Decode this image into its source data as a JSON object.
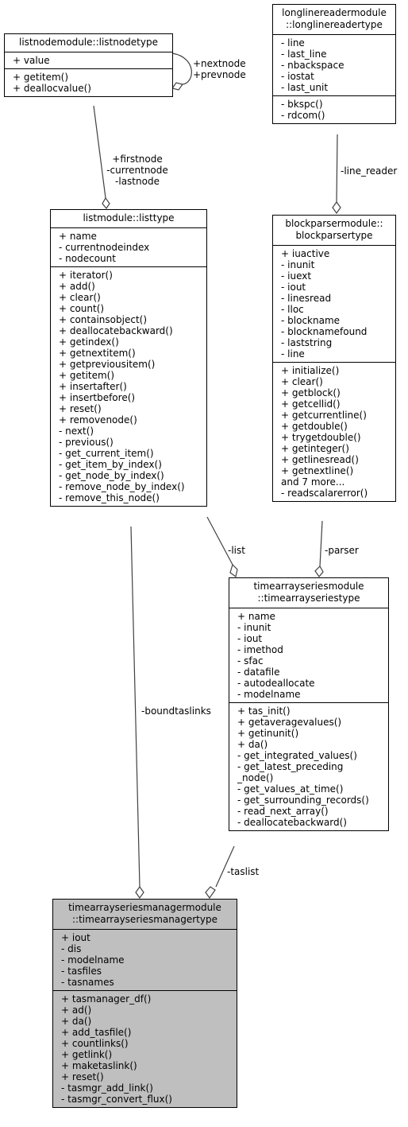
{
  "classes": {
    "listnode": {
      "title": "listnodemodule::listnodetype",
      "attributes": [
        "+ value"
      ],
      "methods": [
        "+ getitem()",
        "+ deallocvalue()"
      ]
    },
    "longlinereader": {
      "title": "longlinereadermodule\n::longlinereadertype",
      "attributes": [
        "- line",
        "- last_line",
        "- nbackspace",
        "- iostat",
        "- last_unit"
      ],
      "methods": [
        "- bkspc()",
        "- rdcom()"
      ]
    },
    "list": {
      "title": "listmodule::listtype",
      "attributes": [
        "+ name",
        "- currentnodeindex",
        "- nodecount"
      ],
      "methods": [
        "+ iterator()",
        "+ add()",
        "+ clear()",
        "+ count()",
        "+ containsobject()",
        "+ deallocatebackward()",
        "+ getindex()",
        "+ getnextitem()",
        "+ getpreviousitem()",
        "+ getitem()",
        "+ insertafter()",
        "+ insertbefore()",
        "+ reset()",
        "+ removenode()",
        "- next()",
        "- previous()",
        "- get_current_item()",
        "- get_item_by_index()",
        "- get_node_by_index()",
        "- remove_node_by_index()",
        "- remove_this_node()"
      ]
    },
    "blockparser": {
      "title": "blockparsermodule::\nblockparsertype",
      "attributes": [
        "+ iuactive",
        "- inunit",
        "- iuext",
        "- iout",
        "- linesread",
        "- lloc",
        "- blockname",
        "- blocknamefound",
        "- laststring",
        "- line"
      ],
      "methods": [
        "+ initialize()",
        "+ clear()",
        "+ getblock()",
        "+ getcellid()",
        "+ getcurrentline()",
        "+ getdouble()",
        "+ trygetdouble()",
        "+ getinteger()",
        "+ getlinesread()",
        "+ getnextline()",
        "and 7 more...",
        "- readscalarerror()"
      ]
    },
    "timearrayseries": {
      "title": "timearrayseriesmodule\n::timearrayseriestype",
      "attributes": [
        "+ name",
        "- inunit",
        "- iout",
        "- imethod",
        "- sfac",
        "- datafile",
        "- autodeallocate",
        "- modelname"
      ],
      "methods": [
        "+ tas_init()",
        "+ getaveragevalues()",
        "+ getinunit()",
        "+ da()",
        "- get_integrated_values()",
        "- get_latest_preceding",
        "_node()",
        "- get_values_at_time()",
        "- get_surrounding_records()",
        "- read_next_array()",
        "- deallocatebackward()"
      ]
    },
    "manager": {
      "title": "timearrayseriesmanagermodule\n::timearrayseriesmanagertype",
      "attributes": [
        "+ iout",
        "- dis",
        "- modelname",
        "- tasfiles",
        "- tasnames"
      ],
      "methods": [
        "+ tasmanager_df()",
        "+ ad()",
        "+ da()",
        "+ add_tasfile()",
        "+ countlinks()",
        "+ getlink()",
        "+ maketaslink()",
        "+ reset()",
        "- tasmgr_add_link()",
        "- tasmgr_convert_flux()"
      ]
    }
  },
  "edges": {
    "self_node": "+nextnode\n+prevnode",
    "node_to_list": "+firstnode\n-currentnode\n-lastnode",
    "reader_to_parser": "-line_reader",
    "list_to_tas": "-list",
    "parser_to_tas": "-parser",
    "list_to_manager": "-boundtaslinks",
    "tas_to_manager": "-taslist"
  },
  "colors": {
    "focus_class_fill": "#bfbfbf",
    "class_fill": "#ffffff",
    "edge_stroke": "#404040"
  }
}
